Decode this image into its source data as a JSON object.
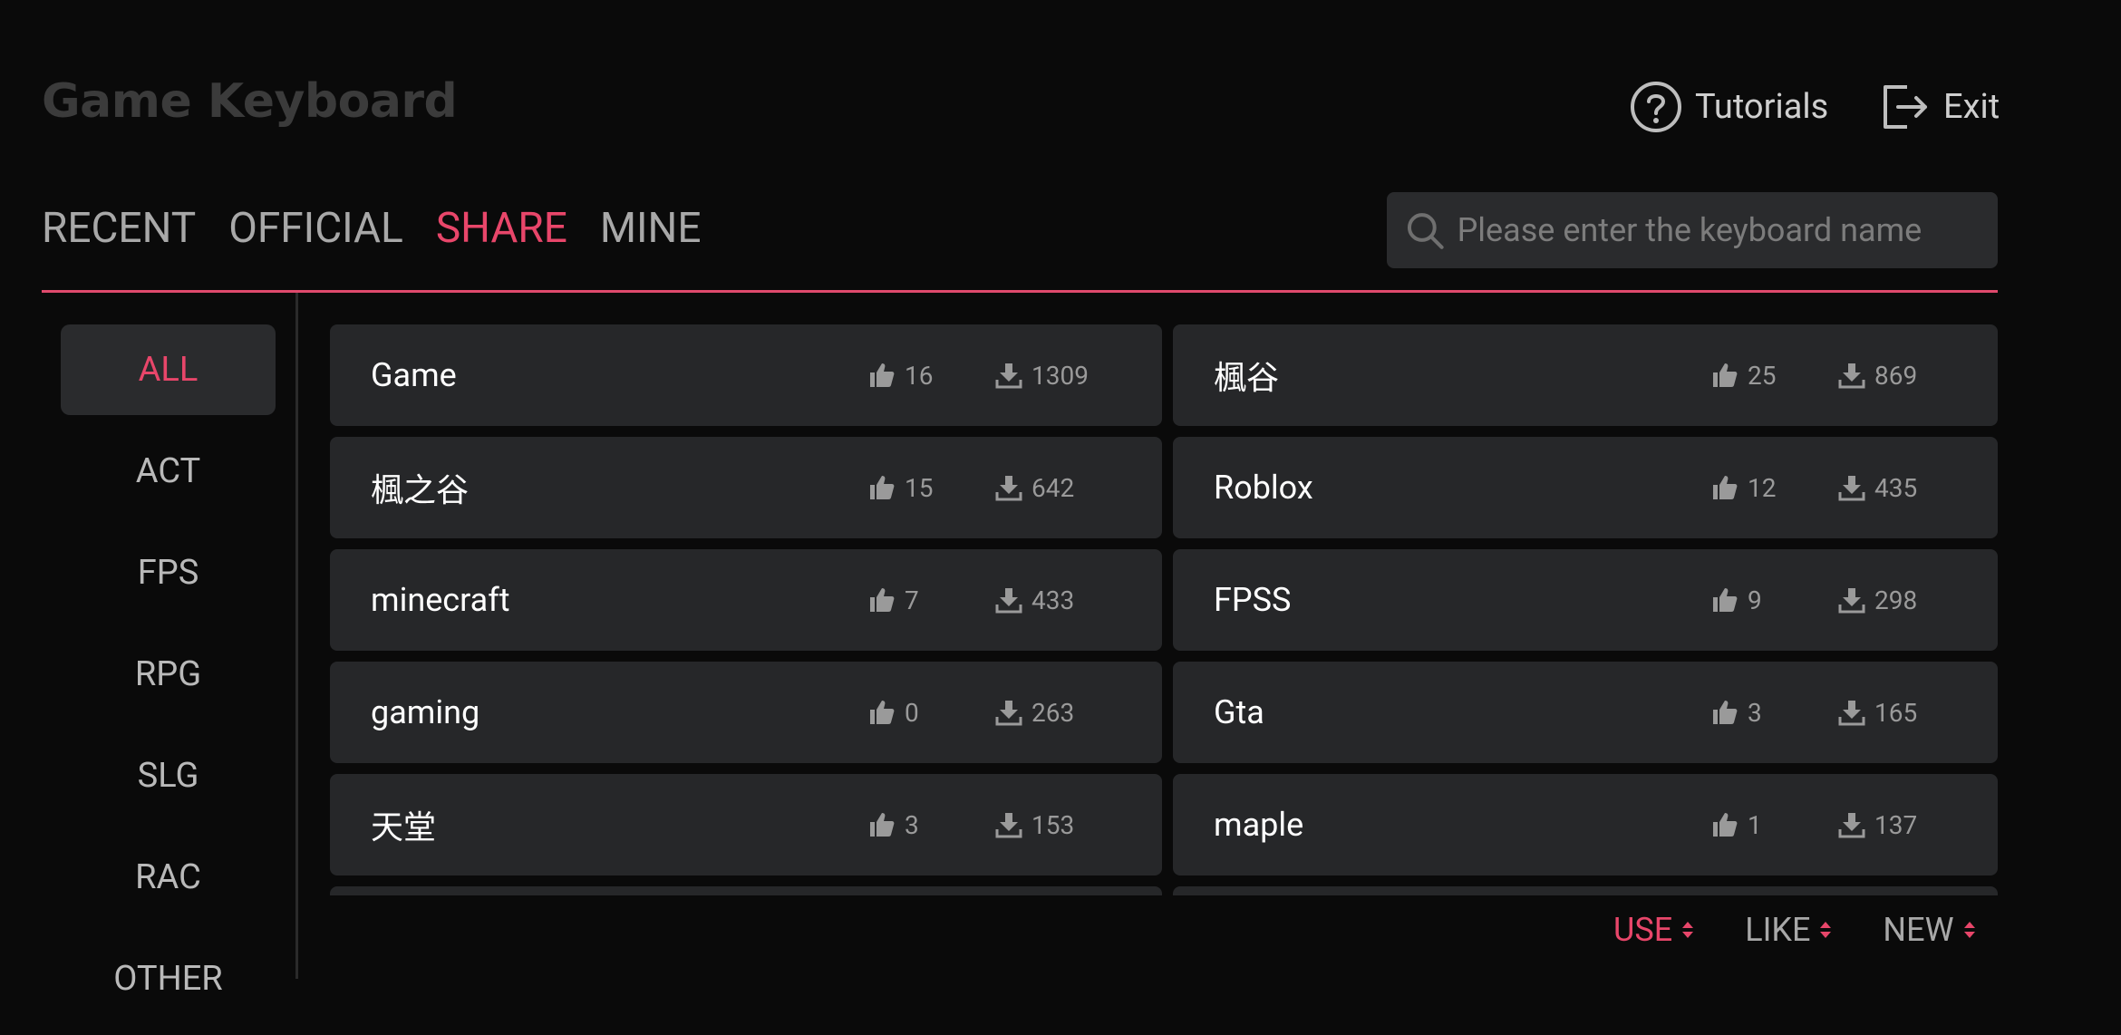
{
  "header": {
    "app_title": "Game Keyboard",
    "tutorials_label": "Tutorials",
    "exit_label": "Exit"
  },
  "tabs": [
    {
      "label": "RECENT",
      "active": false
    },
    {
      "label": "OFFICIAL",
      "active": false
    },
    {
      "label": "SHARE",
      "active": true
    },
    {
      "label": "MINE",
      "active": false
    }
  ],
  "search": {
    "placeholder": "Please enter the keyboard name",
    "value": ""
  },
  "categories": [
    {
      "label": "ALL",
      "active": true
    },
    {
      "label": "ACT",
      "active": false
    },
    {
      "label": "FPS",
      "active": false
    },
    {
      "label": "RPG",
      "active": false
    },
    {
      "label": "SLG",
      "active": false
    },
    {
      "label": "RAC",
      "active": false
    },
    {
      "label": "OTHER",
      "active": false
    }
  ],
  "keyboards": [
    {
      "name": "Game",
      "likes": "16",
      "downloads": "1309"
    },
    {
      "name": "楓谷",
      "likes": "25",
      "downloads": "869"
    },
    {
      "name": "楓之谷",
      "likes": "15",
      "downloads": "642"
    },
    {
      "name": "Roblox",
      "likes": "12",
      "downloads": "435"
    },
    {
      "name": "minecraft",
      "likes": "7",
      "downloads": "433"
    },
    {
      "name": "FPSS",
      "likes": "9",
      "downloads": "298"
    },
    {
      "name": "gaming",
      "likes": "0",
      "downloads": "263"
    },
    {
      "name": "Gta",
      "likes": "3",
      "downloads": "165"
    },
    {
      "name": "天堂",
      "likes": "3",
      "downloads": "153"
    },
    {
      "name": "maple",
      "likes": "1",
      "downloads": "137"
    },
    {
      "name": "",
      "likes": "",
      "downloads": ""
    },
    {
      "name": "",
      "likes": "",
      "downloads": ""
    }
  ],
  "sort": [
    {
      "label": "USE",
      "active": true
    },
    {
      "label": "LIKE",
      "active": false
    },
    {
      "label": "NEW",
      "active": false
    }
  ],
  "colors": {
    "accent": "#e8466a",
    "background": "#0a0a0a",
    "card": "#262729"
  },
  "icons": {
    "help": "question-circle-icon",
    "exit": "exit-icon",
    "search": "search-icon",
    "likes": "thumbs-up-icon",
    "downloads": "download-icon",
    "sort": "sort-arrows-icon"
  }
}
